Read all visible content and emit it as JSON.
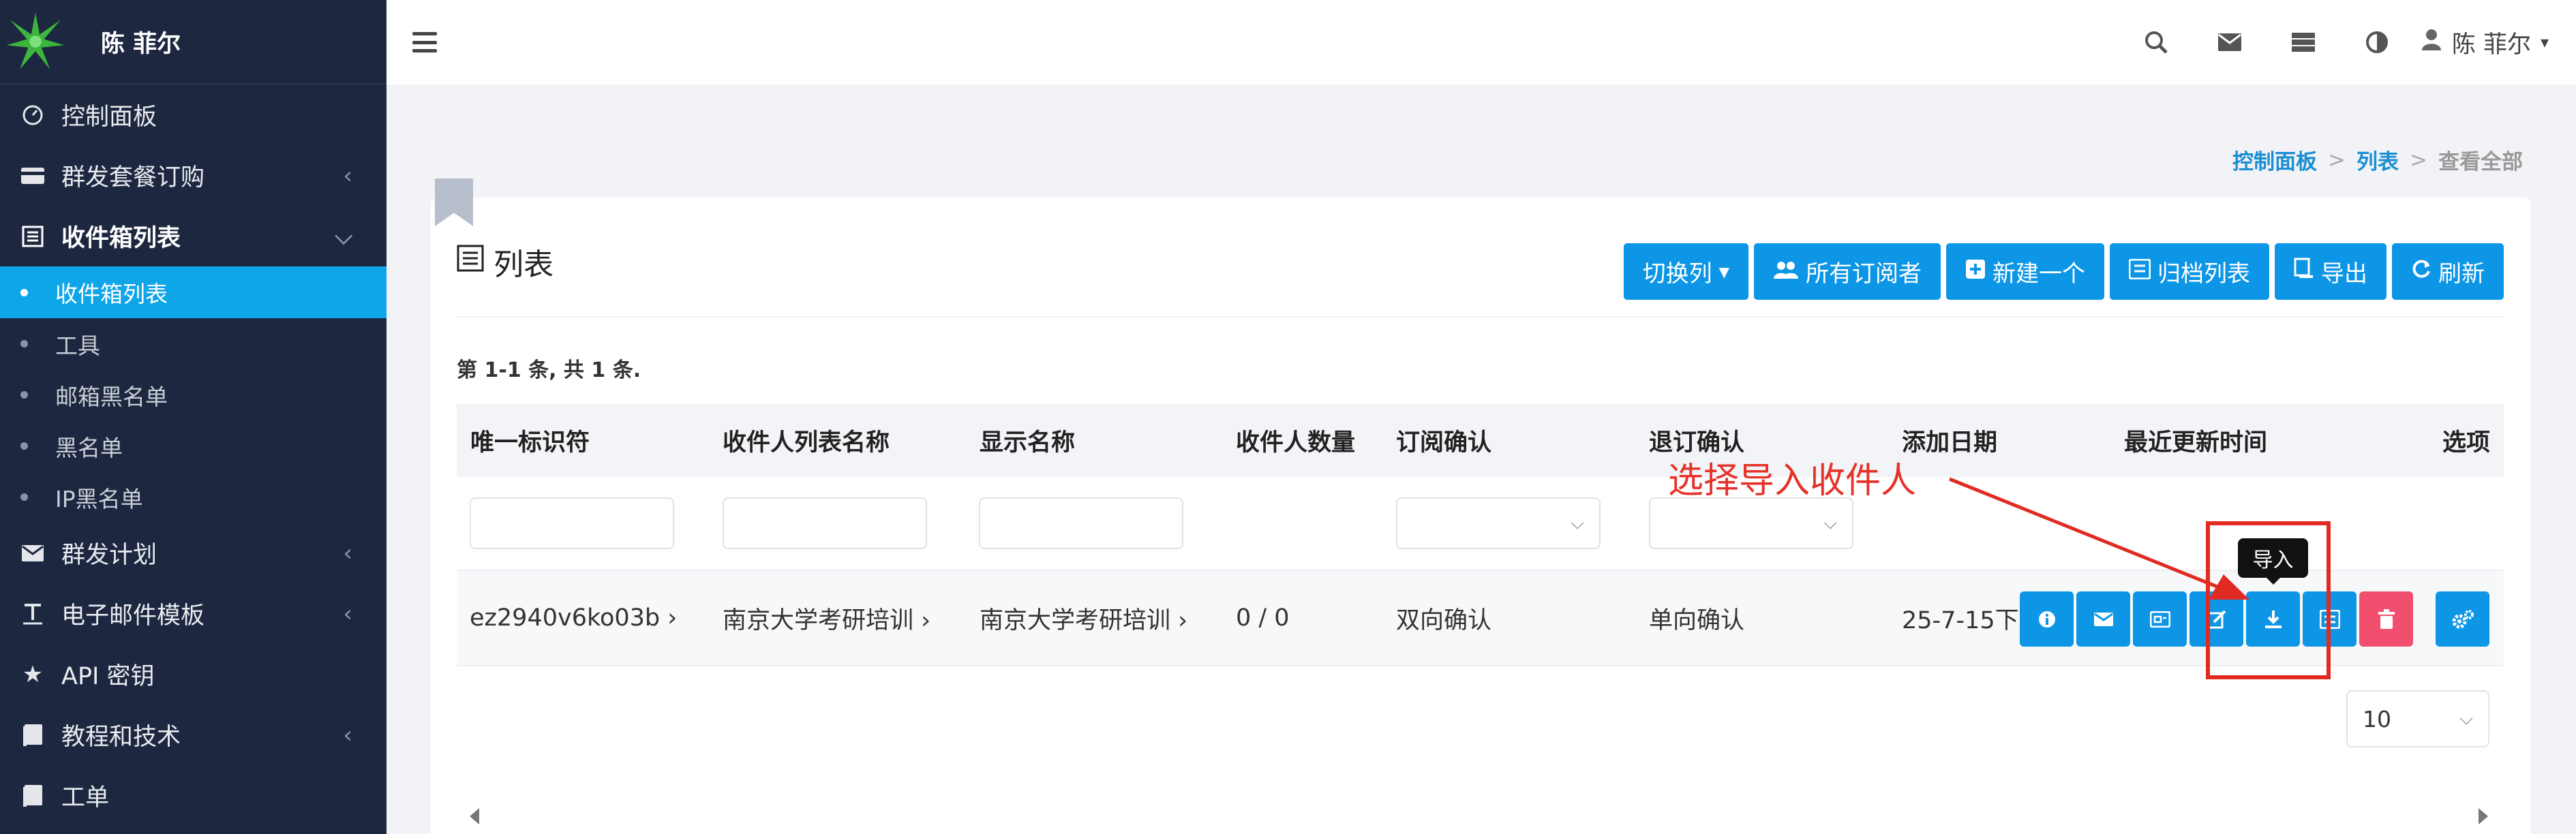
{
  "brand": {
    "name": "陈 菲尔",
    "logo_icon": "green-star-logo"
  },
  "sidebar": {
    "items": [
      {
        "label": "控制面板",
        "icon": "dashboard-icon"
      },
      {
        "label": "群发套餐订购",
        "icon": "card-icon",
        "chevron": "‹"
      },
      {
        "label": "收件箱列表",
        "icon": "list-icon",
        "chevron": "⌵"
      },
      {
        "label": "群发计划",
        "icon": "envelope-icon",
        "chevron": "‹"
      },
      {
        "label": "电子邮件模板",
        "icon": "text-icon",
        "chevron": "‹"
      },
      {
        "label": "API 密钥",
        "icon": "star-icon"
      },
      {
        "label": "教程和技术",
        "icon": "book-icon",
        "chevron": "‹"
      },
      {
        "label": "工单",
        "icon": "book2-icon"
      }
    ],
    "subitems": [
      {
        "label": "收件箱列表",
        "active": true
      },
      {
        "label": "工具"
      },
      {
        "label": "邮箱黑名单"
      },
      {
        "label": "黑名单"
      },
      {
        "label": "IP黑名单"
      }
    ]
  },
  "topbar": {
    "user": "陈 菲尔",
    "caret": "▾"
  },
  "breadcrumb": {
    "home": "控制面板",
    "list": "列表",
    "current": "查看全部",
    "sep": ">"
  },
  "card": {
    "title": "列表",
    "toolbar": {
      "toggle_columns": "切换列",
      "all_subscribers": "所有订阅者",
      "new_one": "新建一个",
      "archive_list": "归档列表",
      "export": "导出",
      "refresh": "刷新"
    },
    "summary": "第 1-1 条, 共 1 条."
  },
  "table": {
    "headers": [
      "唯一标识符",
      "收件人列表名称",
      "显示名称",
      "收件人数量",
      "订阅确认",
      "退订确认",
      "添加日期",
      "最近更新时间",
      "选项"
    ],
    "rows": [
      {
        "id": "ez2940v6ko03b ›",
        "list_name": "南京大学考研培训 ›",
        "display_name": "南京大学考研培训 ›",
        "count": "0 / 0",
        "subscribe_confirm": "双向确认",
        "unsubscribe_confirm": "单向确认",
        "added": "25-7-15下午"
      }
    ]
  },
  "tooltip": "导入",
  "page_size": "10",
  "annotation": {
    "text": "选择导入收件人",
    "color": "#e63228"
  },
  "colors": {
    "primary": "#0d95e6",
    "sidebar": "#1d2840",
    "active": "#0ea5e9",
    "danger": "#f0506e"
  }
}
